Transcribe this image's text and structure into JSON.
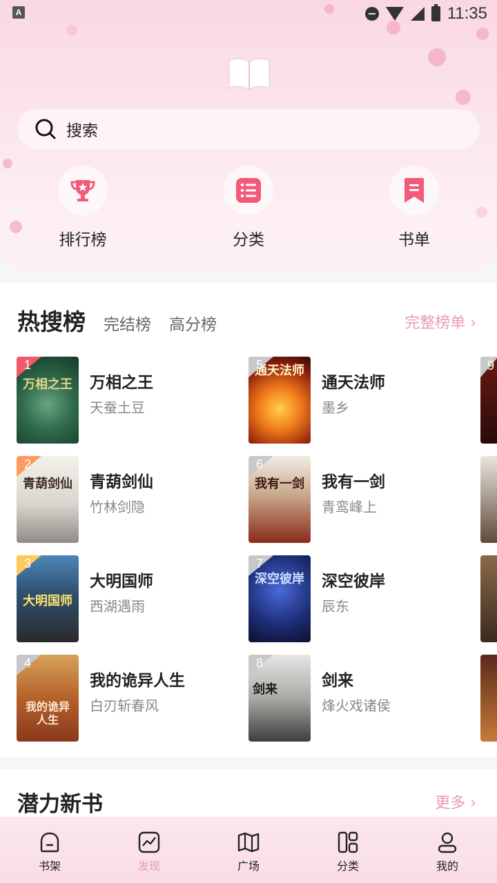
{
  "status_bar": {
    "time": "11:35",
    "notification_icon": "A"
  },
  "search": {
    "placeholder": "搜索"
  },
  "quick_entries": [
    {
      "label": "排行榜",
      "icon": "trophy-icon"
    },
    {
      "label": "分类",
      "icon": "list-icon"
    },
    {
      "label": "书单",
      "icon": "bookmark-icon"
    }
  ],
  "hot": {
    "tabs": [
      "热搜榜",
      "完结榜",
      "高分榜"
    ],
    "full_rank_label": "完整榜单 ›",
    "books": [
      {
        "rank": "1",
        "title": "万相之王",
        "author": "天蚕土豆",
        "cover_text": "万相之王"
      },
      {
        "rank": "2",
        "title": "青葫剑仙",
        "author": "竹林剑隐",
        "cover_text": "青葫剑仙"
      },
      {
        "rank": "3",
        "title": "大明国师",
        "author": "西湖遇雨",
        "cover_text": "大明国师"
      },
      {
        "rank": "4",
        "title": "我的诡异人生",
        "author": "白刃斩春风",
        "cover_text": "我的诡异人生"
      },
      {
        "rank": "5",
        "title": "通天法师",
        "author": "墨乡",
        "cover_text": "通天法师"
      },
      {
        "rank": "6",
        "title": "我有一剑",
        "author": "青鸾峰上",
        "cover_text": "我有一剑"
      },
      {
        "rank": "7",
        "title": "深空彼岸",
        "author": "辰东",
        "cover_text": "深空彼岸"
      },
      {
        "rank": "8",
        "title": "剑来",
        "author": "烽火戏诸侯",
        "cover_text": "剑来"
      }
    ],
    "peek_rank": "9"
  },
  "potential": {
    "title": "潜力新书",
    "more_label": "更多 ›"
  },
  "nav": [
    {
      "label": "书架",
      "icon": "bookshelf-icon"
    },
    {
      "label": "发现",
      "icon": "discover-icon",
      "active": true
    },
    {
      "label": "广场",
      "icon": "map-icon"
    },
    {
      "label": "分类",
      "icon": "category-icon"
    },
    {
      "label": "我的",
      "icon": "profile-icon"
    }
  ],
  "colors": {
    "accent": "#e79ab6",
    "header_bg": "#fbe3ec",
    "icon_red": "#f25a7a"
  }
}
